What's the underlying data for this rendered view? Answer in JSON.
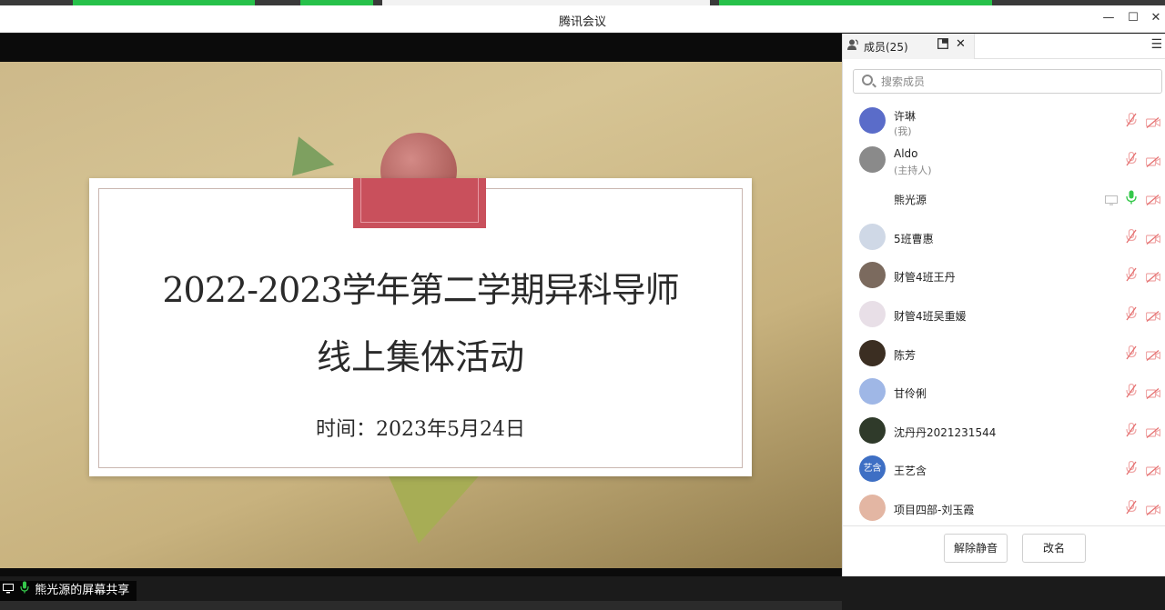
{
  "window": {
    "title": "腾讯会议"
  },
  "slide": {
    "line1": "2022-2023学年第二学期异科导师",
    "line2": "线上集体活动",
    "line3": "时间：2023年5月24日"
  },
  "share": {
    "label": "熊光源的屏幕共享"
  },
  "panel": {
    "tab_label": "成员(25)",
    "search_placeholder": "搜索成员",
    "members": [
      {
        "name": "许琳",
        "role": "(我)",
        "avatar": "#5a6cc9",
        "text": "",
        "mic": "muted",
        "screen": false
      },
      {
        "name": "Aldo",
        "role": "(主持人)",
        "avatar": "#8a8a8a",
        "text": "",
        "mic": "muted",
        "screen": false
      },
      {
        "name": "熊光源",
        "role": "",
        "avatar": "#ffffff",
        "text": "",
        "mic": "on",
        "screen": true
      },
      {
        "name": "5班曹惠",
        "role": "",
        "avatar": "#cfd8e6",
        "text": "",
        "mic": "muted",
        "screen": false
      },
      {
        "name": "财管4班王丹",
        "role": "",
        "avatar": "#7b6a5e",
        "text": "",
        "mic": "muted",
        "screen": false
      },
      {
        "name": "财管4班吴重媛",
        "role": "",
        "avatar": "#e8dfe7",
        "text": "",
        "mic": "muted",
        "screen": false
      },
      {
        "name": "陈芳",
        "role": "",
        "avatar": "#3b2e22",
        "text": "",
        "mic": "muted",
        "screen": false
      },
      {
        "name": "甘伶俐",
        "role": "",
        "avatar": "#9fb7e6",
        "text": "",
        "mic": "muted",
        "screen": false
      },
      {
        "name": "沈丹丹2021231544",
        "role": "",
        "avatar": "#2f3a2a",
        "text": "",
        "mic": "muted",
        "screen": false
      },
      {
        "name": "王艺含",
        "role": "",
        "avatar": "#3e6fc4",
        "text": "艺含",
        "mic": "muted",
        "screen": false
      },
      {
        "name": "项目四部-刘玉霞",
        "role": "",
        "avatar": "#e3b6a3",
        "text": "",
        "mic": "muted",
        "screen": false
      }
    ],
    "unmute_all_label": "解除静音",
    "rename_label": "改名"
  }
}
